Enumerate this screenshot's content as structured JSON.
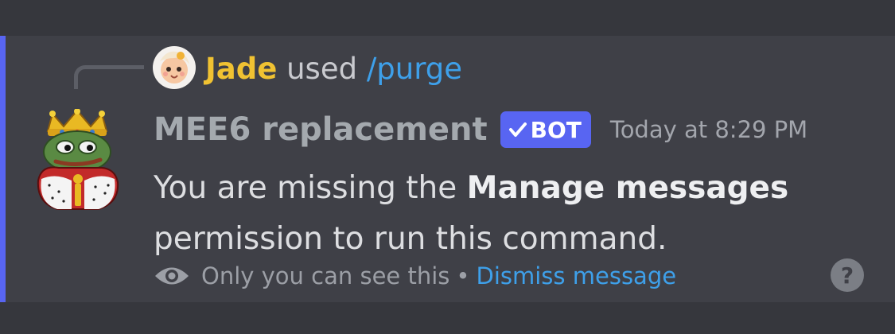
{
  "reply": {
    "username": "Jade",
    "verb": "used",
    "command": "/purge"
  },
  "message": {
    "username": "MEE6 replacement",
    "bot_tag": "BOT",
    "timestamp": "Today at 8:29 PM",
    "content_before": "You are missing the ",
    "content_bold": "Manage messages",
    "content_after": " permission to run this command."
  },
  "footer": {
    "ephemeral_text": "Only you can see this",
    "separator": "•",
    "dismiss_label": "Dismiss message",
    "help_label": "?"
  },
  "icons": {
    "eye": "eye-icon",
    "check": "check-icon",
    "help": "question-mark-icon"
  },
  "colors": {
    "accent": "#5865f2",
    "reply_username": "#f0c232",
    "link": "#3ea0ea",
    "background": "#36373d",
    "message_highlight": "#3f4047"
  }
}
